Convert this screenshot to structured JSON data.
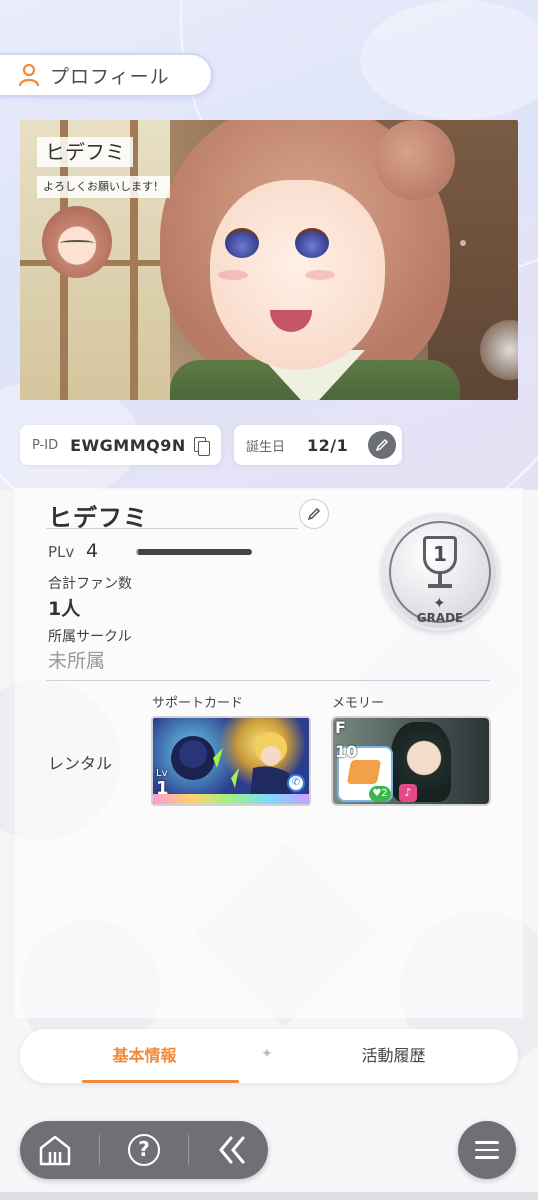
{
  "header": {
    "title": "プロフィール",
    "icon": "person-icon"
  },
  "banner": {
    "player_name": "ヒデフミ",
    "comment": "よろしくお願いします！"
  },
  "ids": {
    "pid_label": "P-ID",
    "pid_value": "EWGMMQ9N",
    "birthday_label": "誕生日",
    "birthday_value": "12/1"
  },
  "profile": {
    "name": "ヒデフミ",
    "plv_label": "PLv",
    "plv_value": "4",
    "plv_progress": 0.02,
    "fans_label": "合計ファン数",
    "fans_value": "1人",
    "circle_label": "所属サークル",
    "circle_value": "未所属",
    "grade_number": "1",
    "grade_text": "GRADE"
  },
  "rental": {
    "label": "レンタル",
    "support_card_label": "サポートカード",
    "support_card_lv_label": "Lv",
    "support_card_lv": "1",
    "memory_label": "メモリー",
    "memory_rank": "F",
    "memory_level": "10",
    "memory_badge": "2"
  },
  "tabs": [
    {
      "label": "基本情報",
      "active": true
    },
    {
      "label": "活動履歴",
      "active": false
    }
  ],
  "nav": {
    "home_icon": "home-icon",
    "help_icon": "help-icon",
    "back_icon": "back-icon",
    "menu_icon": "menu-icon"
  },
  "colors": {
    "accent": "#f08a3c",
    "nav_bg": "#6f6f75",
    "progress": "#6cc4e8"
  }
}
